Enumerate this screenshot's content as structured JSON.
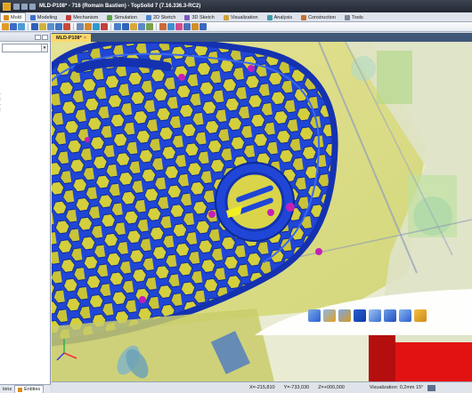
{
  "title_bar": {
    "title": "MLD-P108* - 716 (Romain Bastien) - TopSolid 7 (7.16.336.3-RC2)"
  },
  "ribbon_tabs": [
    {
      "label": "Mold",
      "icon": "mold-icon",
      "active": true
    },
    {
      "label": "Modeling",
      "icon": "modeling-icon"
    },
    {
      "label": "Mechanism",
      "icon": "mechanism-icon"
    },
    {
      "label": "Simulation",
      "icon": "simulation-icon"
    },
    {
      "label": "2D Sketch",
      "icon": "2d-sketch-icon"
    },
    {
      "label": "3D Sketch",
      "icon": "3d-sketch-icon"
    },
    {
      "label": "Visualization",
      "icon": "visualization-icon"
    },
    {
      "label": "Analysis",
      "icon": "analysis-icon"
    },
    {
      "label": "Construction",
      "icon": "construction-icon"
    },
    {
      "label": "Tools",
      "icon": "tools-icon"
    }
  ],
  "document_tab": {
    "label": "MLD-P108*",
    "close": "×"
  },
  "left_panel": {
    "bottom_tabs": [
      {
        "label": "ions",
        "active": false
      },
      {
        "label": "Entities",
        "active": true
      }
    ]
  },
  "status_bar": {
    "x": "X=-215,810",
    "y": "Y=-733,030",
    "z": "Z=+000,000",
    "visualization": "Visualization: 0,2mm 15°"
  },
  "colors": {
    "title_bar": "#2a313d",
    "part_blue": "#1f46d6",
    "mold_yellow": "#d8d44a",
    "viewport_bg": "#eef0d8",
    "accent_red": "#e31212",
    "pin_magenta": "#c51fb8"
  },
  "command_bar_icons": [
    "face-icon",
    "face-extend-icon",
    "face-fill-icon",
    "box-icon",
    "parting-line-icon",
    "split-icon",
    "draft-icon",
    "slider-icon"
  ]
}
